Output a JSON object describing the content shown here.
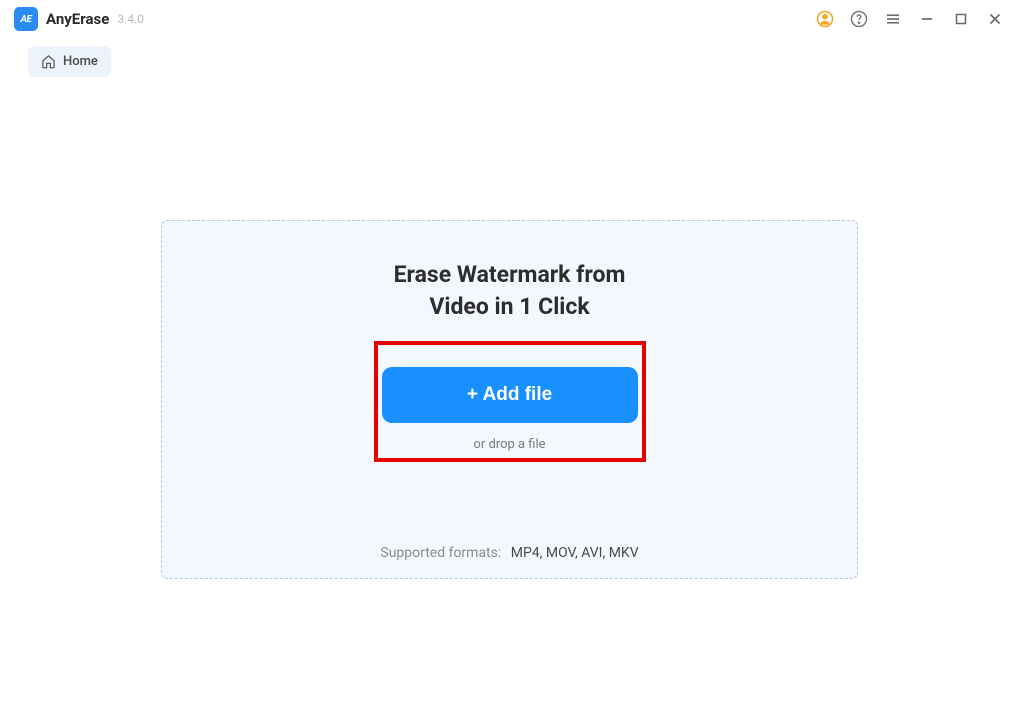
{
  "titlebar": {
    "logo_text": "AE",
    "app_name": "AnyErase",
    "app_version": "3.4.0"
  },
  "breadcrumb": {
    "home_label": "Home"
  },
  "main": {
    "heading_line1": "Erase Watermark from",
    "heading_line2": "Video in 1 Click",
    "add_file_label": "+ Add file",
    "drop_hint": "or drop a file",
    "supported_label": "Supported formats:",
    "supported_formats": "MP4, MOV, AVI, MKV"
  }
}
